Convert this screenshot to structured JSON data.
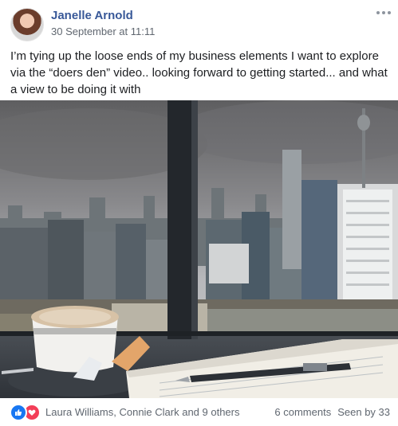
{
  "post": {
    "author": "Janelle Arnold",
    "timestamp": "30 September at 11:11",
    "text": "I’m tying up the loose ends of my business elements I want to explore via the “doers den” video.. looking forward to getting started... and what a view to be doing it with"
  },
  "footer": {
    "reactors": "Laura Williams, Connie Clark and 9 others",
    "comments": "6 comments",
    "seen": "Seen by 33"
  },
  "colors": {
    "author": "#385898",
    "like": "#1877f2",
    "love": "#f33e58",
    "secondary_text": "#606770"
  },
  "icons": [
    "more-icon",
    "like-reaction-icon",
    "love-reaction-icon"
  ]
}
